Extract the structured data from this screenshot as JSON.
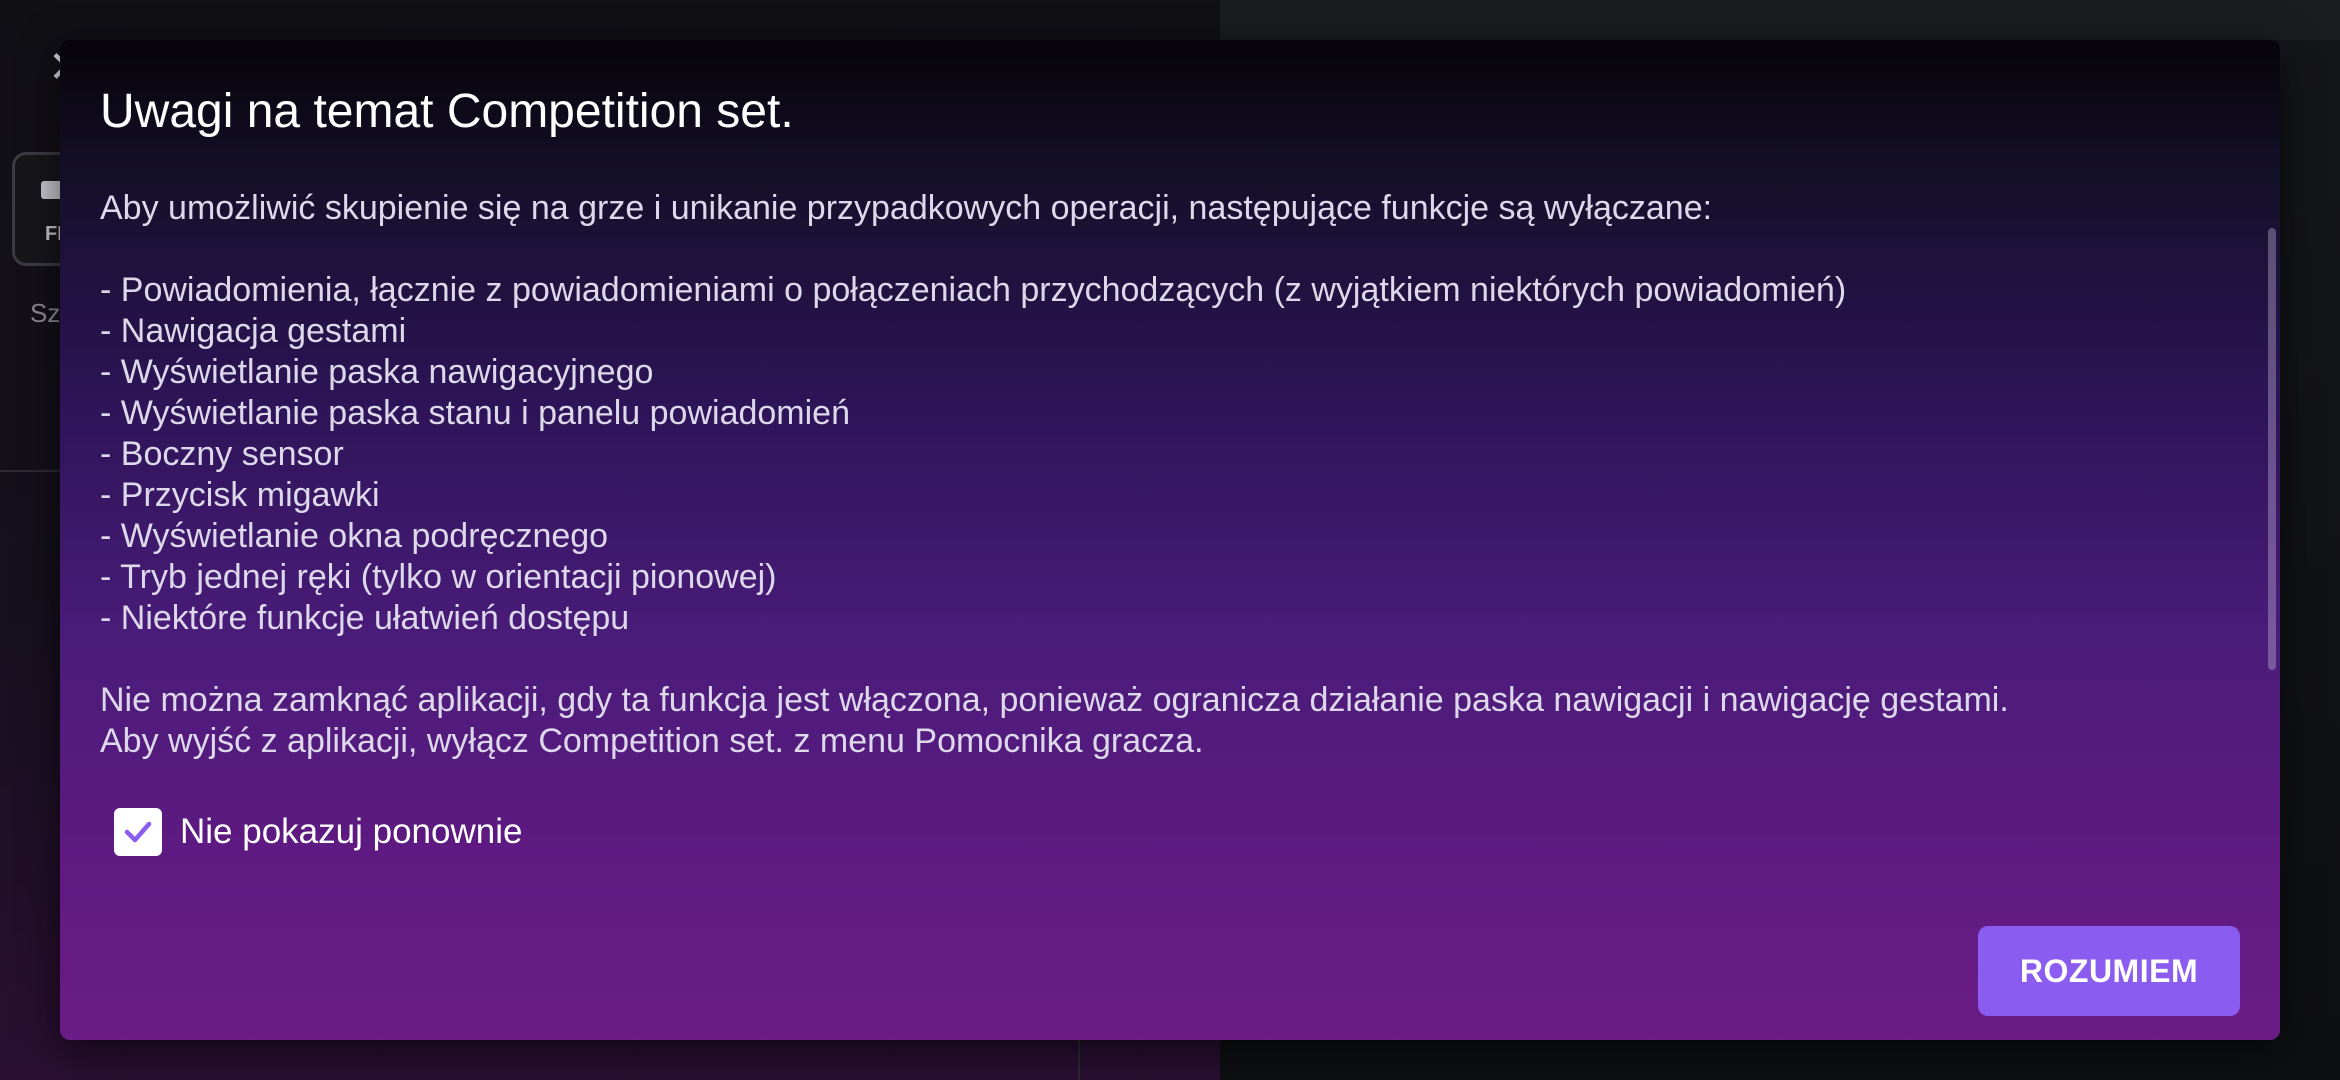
{
  "background": {
    "close_glyph": "✕",
    "fps_tile_text": "FPS",
    "section_label": "Sz"
  },
  "dialog": {
    "title": "Uwagi na temat Competition set.",
    "intro": "Aby umożliwić skupienie się na grze i unikanie przypadkowych operacji, następujące funkcje są wyłączane:",
    "items": [
      "- Powiadomienia, łącznie z powiadomieniami o połączeniach przychodzących (z wyjątkiem niektórych powiadomień)",
      "- Nawigacja gestami",
      "- Wyświetlanie paska nawigacyjnego",
      "- Wyświetlanie paska stanu i panelu powiadomień",
      "- Boczny sensor",
      "- Przycisk migawki",
      "- Wyświetlanie okna podręcznego",
      "- Tryb jednej ręki (tylko w orientacji pionowej)",
      "- Niektóre funkcje ułatwień dostępu"
    ],
    "outro_line_1": "Nie można zamknąć aplikacji, gdy ta funkcja jest włączona, ponieważ ogranicza działanie paska nawigacji i nawigację gestami.",
    "outro_line_2": "Aby wyjść z aplikacji, wyłącz Competition set. z menu Pomocnika gracza.",
    "checkbox": {
      "label": "Nie pokazuj ponownie",
      "checked": true,
      "check_color": "#8b5cf0"
    },
    "button_label": "ROZUMIEM",
    "accent_color": "#8b5cf0"
  }
}
